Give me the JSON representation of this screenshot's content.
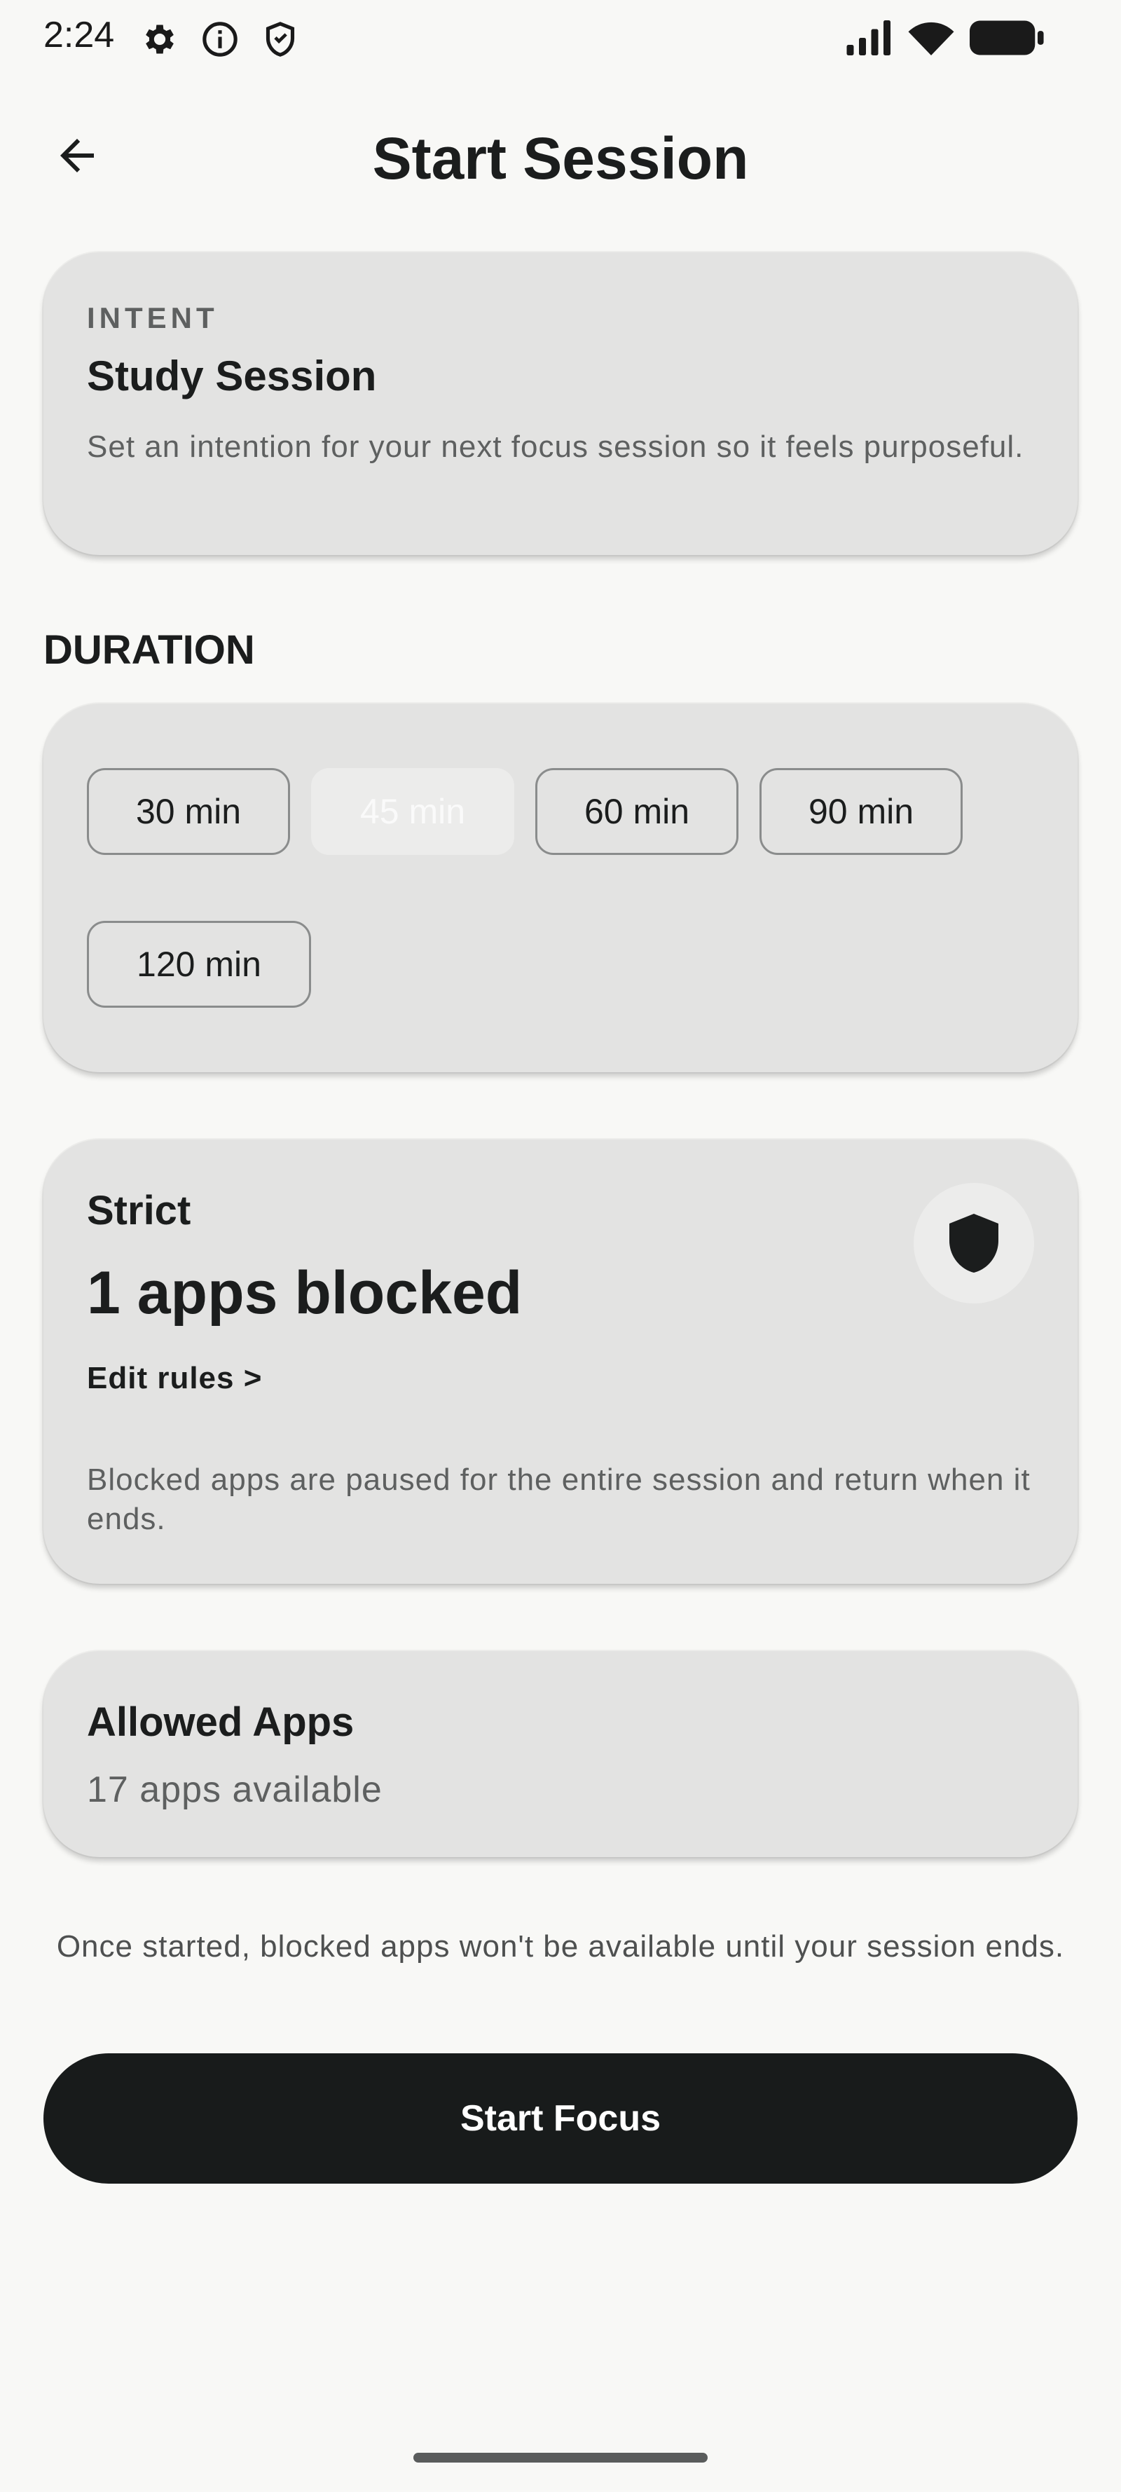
{
  "status_bar": {
    "time": "2:24",
    "left_icons": [
      "gear-icon",
      "info-icon",
      "shield-outline-icon"
    ],
    "right_icons": [
      "signal-icon",
      "wifi-icon",
      "battery-icon"
    ]
  },
  "header": {
    "back_icon": "arrow-left-icon",
    "title": "Start Session"
  },
  "intent": {
    "label": "INTENT",
    "title": "Study Session",
    "description": "Set an intention for your next focus session so it feels purposeful."
  },
  "duration": {
    "heading": "DURATION",
    "options": [
      "30 min",
      "45 min",
      "60 min",
      "90 min",
      "120 min"
    ],
    "selected": "45 min"
  },
  "strict": {
    "label": "Strict",
    "blocked_count": "1 apps blocked",
    "edit_rules": "Edit rules >",
    "description": "Blocked apps are paused for the entire session and return when it ends.",
    "icon": "shield-icon"
  },
  "allowed": {
    "title": "Allowed Apps",
    "subtitle": "17 apps available"
  },
  "notice": "Once started, blocked apps won't be available until your session ends.",
  "start_button": "Start Focus",
  "colors": {
    "background": "#f8f8f6",
    "card": "#e3e3e2",
    "primary_button": "#181b1b",
    "text_primary": "#1b1d1d",
    "text_secondary": "#5e6060"
  }
}
